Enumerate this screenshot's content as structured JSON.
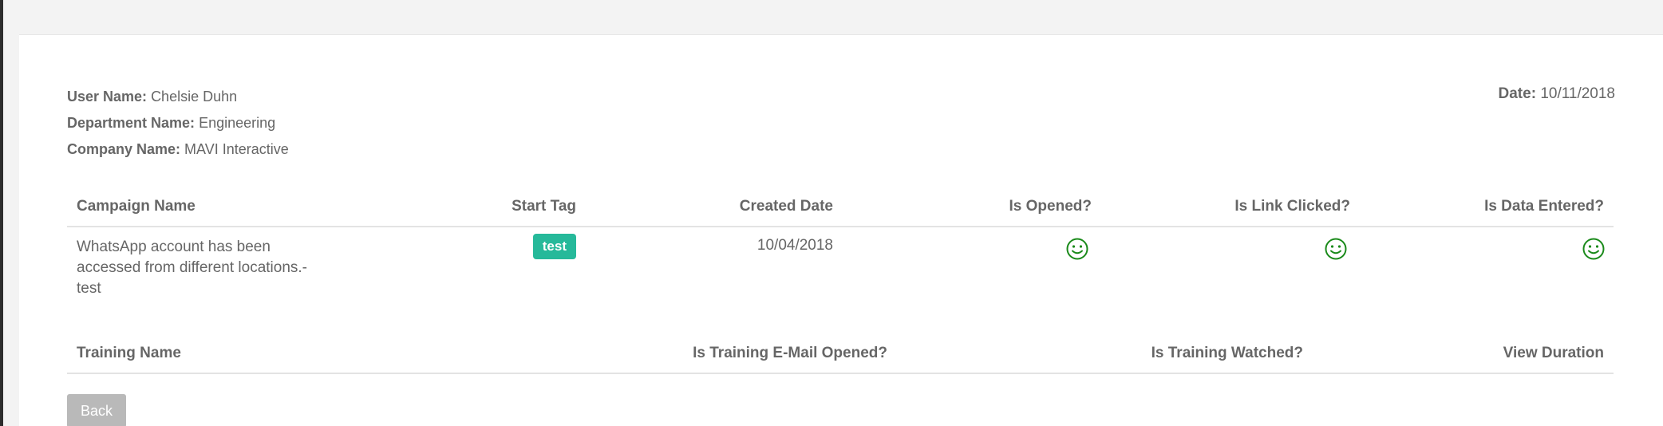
{
  "user_info": {
    "user_name_label": "User Name:",
    "user_name": "Chelsie Duhn",
    "department_label": "Department Name:",
    "department": "Engineering",
    "company_label": "Company Name:",
    "company": "MAVI Interactive",
    "date_label": "Date:",
    "date": "10/11/2018"
  },
  "campaign_table": {
    "headers": [
      "Campaign Name",
      "Start Tag",
      "Created Date",
      "Is Opened?",
      "Is Link Clicked?",
      "Is Data Entered?"
    ],
    "rows": [
      {
        "campaign_name": "WhatsApp account has been accessed from different locations.-test",
        "start_tag": "test",
        "created_date": "10/04/2018",
        "is_opened_icon": "smile-icon",
        "is_link_clicked_icon": "smile-icon",
        "is_data_entered_icon": "smile-icon"
      }
    ]
  },
  "training_table": {
    "headers": [
      "Training Name",
      "Is Training E-Mail Opened?",
      "Is Training Watched?",
      "View Duration"
    ]
  },
  "actions": {
    "back_label": "Back"
  },
  "colors": {
    "tag_bg": "#26b99a",
    "smile": "#1a8a1a",
    "back_bg": "#b9b9b9"
  }
}
